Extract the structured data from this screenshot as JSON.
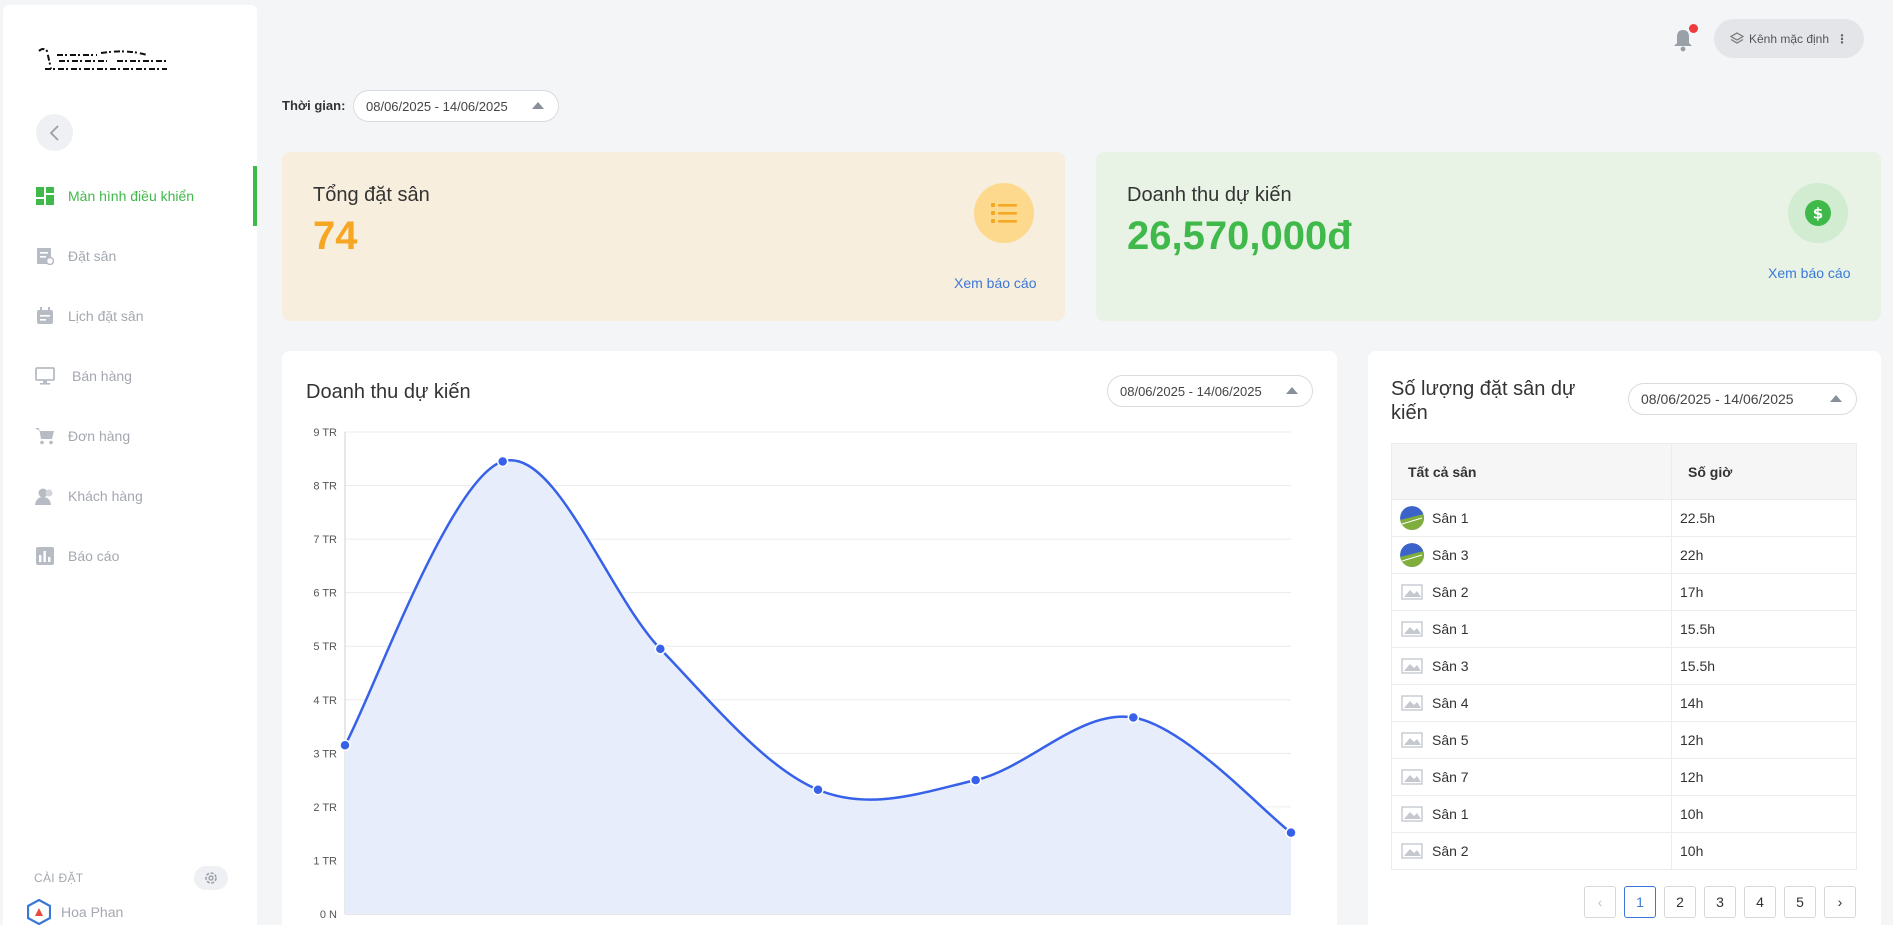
{
  "app": {
    "notifications": {
      "unread": true
    },
    "channel_label": "Kênh mặc định"
  },
  "sidebar": {
    "items": [
      {
        "label": "Màn hình điều khiển",
        "icon": "dashboard-icon",
        "active": true
      },
      {
        "label": "Đặt sân",
        "icon": "booking-icon",
        "active": false
      },
      {
        "label": "Lịch đặt sân",
        "icon": "calendar-icon",
        "active": false
      },
      {
        "label": "Bán hàng",
        "icon": "monitor-icon",
        "active": false
      },
      {
        "label": "Đơn hàng",
        "icon": "cart-icon",
        "active": false
      },
      {
        "label": "Khách hàng",
        "icon": "customers-icon",
        "active": false
      },
      {
        "label": "Báo cáo",
        "icon": "report-icon",
        "active": false
      }
    ],
    "settings_label": "CÀI ĐẶT",
    "user_name": "Hoa Phan"
  },
  "filters": {
    "time_label": "Thời gian:",
    "date_range": "08/06/2025 - 14/06/2025"
  },
  "stats": {
    "bookings": {
      "title": "Tổng đặt sân",
      "value": "74",
      "link": "Xem báo cáo"
    },
    "revenue": {
      "title": "Doanh thu dự kiến",
      "value": "26,570,000đ",
      "link": "Xem báo cáo"
    }
  },
  "revenue_chart": {
    "title": "Doanh thu dự kiến",
    "date_range": "08/06/2025 - 14/06/2025"
  },
  "chart_data": {
    "type": "area",
    "title": "Doanh thu dự kiến",
    "xlabel": "",
    "ylabel": "",
    "y_ticks": [
      "0 N",
      "1 TR",
      "2 TR",
      "3 TR",
      "4 TR",
      "5 TR",
      "6 TR",
      "7 TR",
      "8 TR",
      "9 TR"
    ],
    "ylim": [
      0,
      9000000
    ],
    "x": [
      0,
      1,
      2,
      3,
      4,
      5,
      6
    ],
    "values": [
      3150000,
      8450000,
      4950000,
      2320000,
      2500000,
      3670000,
      1520000
    ],
    "line_color": "#3661e8",
    "fill_color": "#e7edfb",
    "grid": true
  },
  "courts": {
    "title": "Số lượng đặt sân dự kiến",
    "date_range": "08/06/2025 - 14/06/2025",
    "columns": [
      "Tất cả sân",
      "Số giờ"
    ],
    "rows": [
      {
        "name": "Sân 1",
        "hours": "22.5h",
        "image": true
      },
      {
        "name": "Sân 3",
        "hours": "22h",
        "image": true
      },
      {
        "name": "Sân 2",
        "hours": "17h",
        "image": false
      },
      {
        "name": "Sân 1",
        "hours": "15.5h",
        "image": false
      },
      {
        "name": "Sân 3",
        "hours": "15.5h",
        "image": false
      },
      {
        "name": "Sân 4",
        "hours": "14h",
        "image": false
      },
      {
        "name": "Sân 5",
        "hours": "12h",
        "image": false
      },
      {
        "name": "Sân 7",
        "hours": "12h",
        "image": false
      },
      {
        "name": "Sân 1",
        "hours": "10h",
        "image": false
      },
      {
        "name": "Sân 2",
        "hours": "10h",
        "image": false
      }
    ],
    "pagination": {
      "current": 1,
      "pages": [
        "1",
        "2",
        "3",
        "4",
        "5"
      ]
    }
  },
  "colors": {
    "accent": "#3fb94a",
    "link": "#3a78d8",
    "orange": "#f5a623"
  }
}
